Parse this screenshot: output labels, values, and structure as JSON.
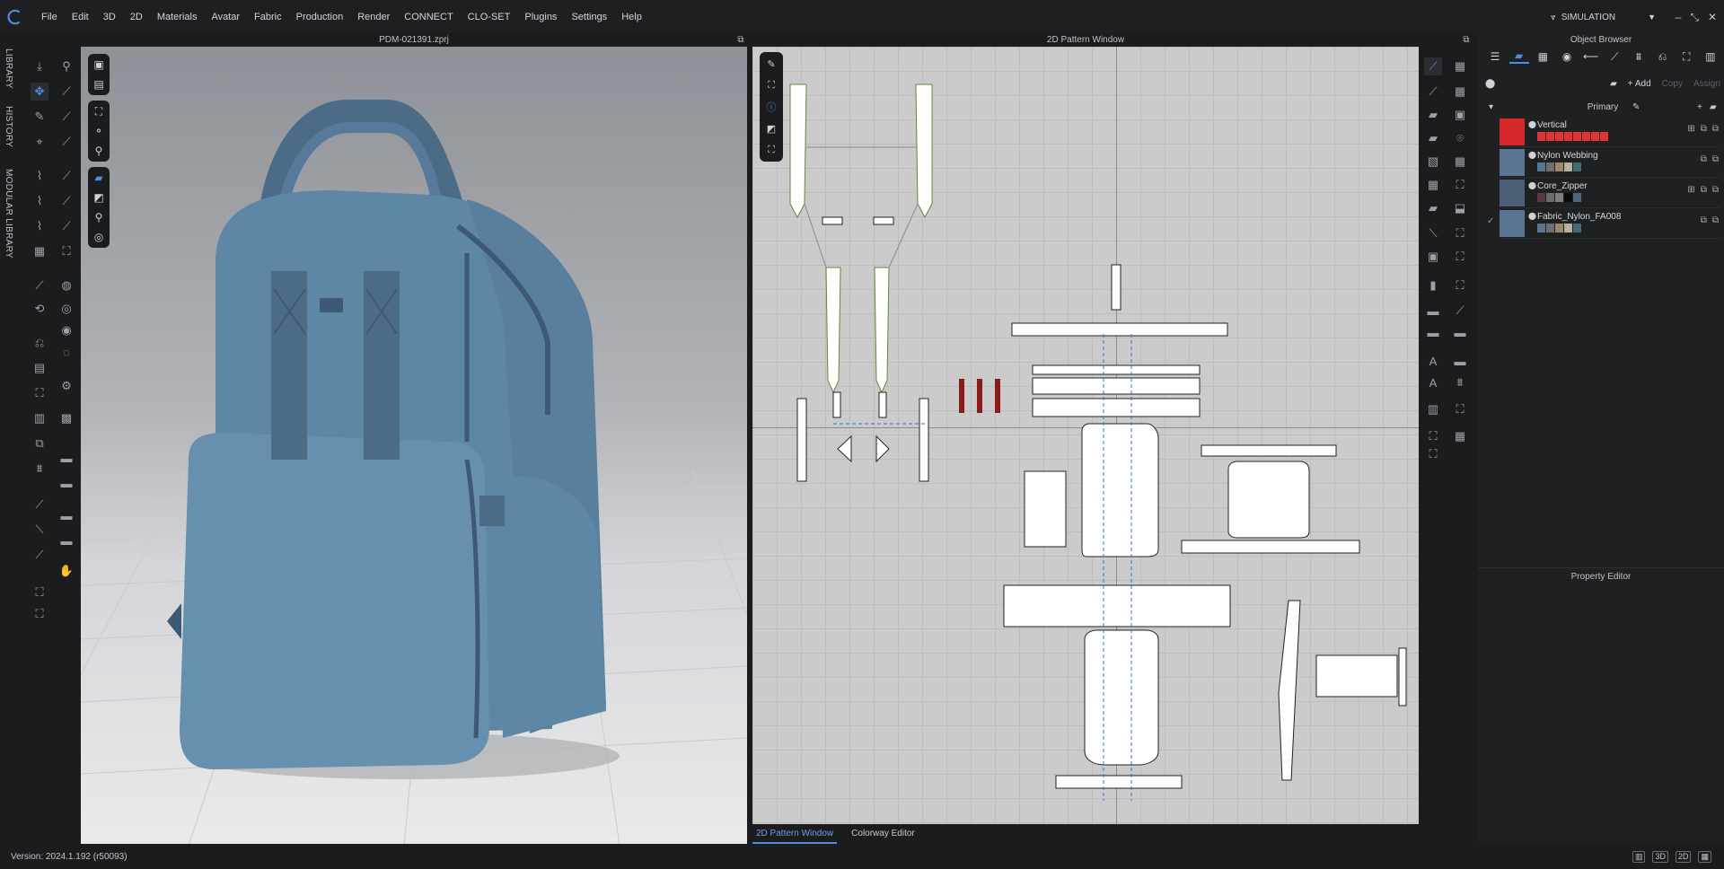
{
  "app": {
    "logo": "clo-logo-icon"
  },
  "menu": [
    "File",
    "Edit",
    "3D",
    "2D",
    "Materials",
    "Avatar",
    "Fabric",
    "Production",
    "Render",
    "CONNECT",
    "CLO-SET",
    "Plugins",
    "Settings",
    "Help"
  ],
  "simulation": {
    "label": "SIMULATION"
  },
  "left_tabs": [
    "LIBRARY",
    "HISTORY",
    "MODULAR LIBRARY"
  ],
  "view3d": {
    "title": "PDM-021391.zprj"
  },
  "view2d": {
    "title": "2D Pattern Window"
  },
  "bottom_tabs": {
    "active": "2D Pattern Window",
    "other": "Colorway Editor"
  },
  "object_browser": {
    "title": "Object Browser",
    "add_label": "+ Add",
    "copy_label": "Copy",
    "assign_label": "Assign",
    "group_label": "Primary",
    "materials": [
      {
        "name": "Vertical",
        "thumb_color": "#d62a2a",
        "swatches": [
          "#e03434",
          "#e03434",
          "#e03434",
          "#e03434",
          "#e03434",
          "#e03434",
          "#e03434",
          "#e03434"
        ]
      },
      {
        "name": "Nylon Webbing",
        "thumb_color": "#5a7593",
        "swatches": [
          "#5a7593",
          "#6e6f72",
          "#9a8a6a",
          "#b8b1a0",
          "#3f6c72"
        ]
      },
      {
        "name": "Core_Zipper",
        "thumb_color": "#4d5f76",
        "swatches": [
          "#5a3a3e",
          "#6a6b6e",
          "#7d7e80",
          "#0b0b0c",
          "#4d6482"
        ]
      },
      {
        "name": "Fabric_Nylon_FA008",
        "thumb_color": "#5a7593",
        "swatches": [
          "#5a7593",
          "#6e6f72",
          "#9a8a6a",
          "#b8b1a0",
          "#3f6c72"
        ]
      }
    ]
  },
  "property_editor": {
    "title": "Property Editor"
  },
  "status": {
    "version": "Version: 2024.1.192 (r50093)"
  },
  "colors": {
    "accent": "#4f8de0",
    "bag": "#5f86a4"
  }
}
